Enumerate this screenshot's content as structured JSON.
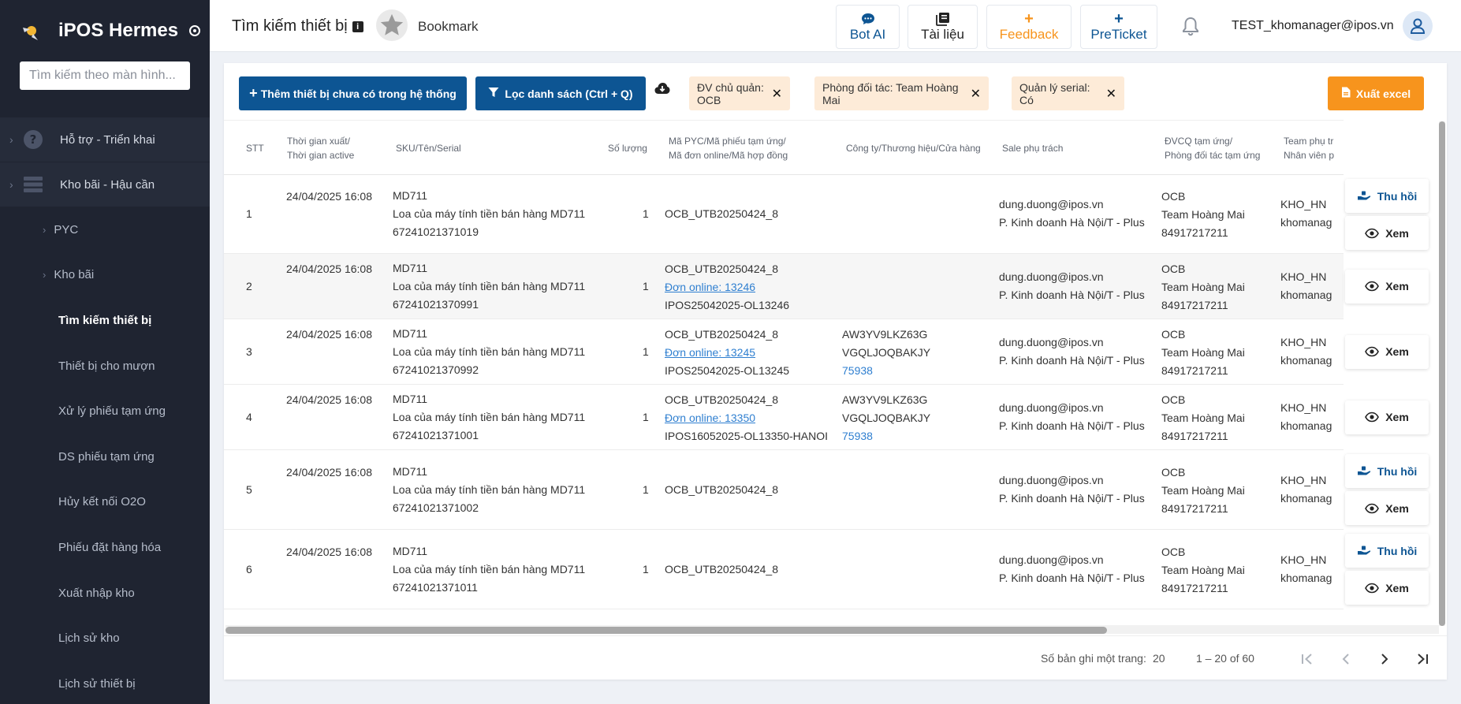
{
  "app": {
    "name": "iPOS Hermes"
  },
  "sidebar": {
    "search_placeholder": "Tìm kiếm theo màn hình...",
    "groups": [
      {
        "label": "Hỗ trợ - Triển khai",
        "icon": "help-circle-icon"
      },
      {
        "label": "Kho bãi - Hậu cần",
        "icon": "server-icon"
      }
    ],
    "subgroups": [
      {
        "label": "PYC"
      },
      {
        "label": "Kho bãi"
      }
    ],
    "items": [
      {
        "label": "Tìm kiếm thiết bị",
        "active": true
      },
      {
        "label": "Thiết bị cho mượn"
      },
      {
        "label": "Xử lý phiếu tạm ứng"
      },
      {
        "label": "DS phiếu tạm ứng"
      },
      {
        "label": "Hủy kết nối O2O"
      },
      {
        "label": "Phiếu đặt hàng hóa"
      },
      {
        "label": "Xuất nhập kho"
      },
      {
        "label": "Lịch sử kho"
      },
      {
        "label": "Lịch sử thiết bị"
      }
    ]
  },
  "header": {
    "title": "Tìm kiếm thiết bị",
    "info_glyph": "i",
    "bookmark": "Bookmark",
    "buttons": [
      {
        "label": "Bot AI",
        "icon": "chat-bubble-icon",
        "color": "#0d5593"
      },
      {
        "label": "Tài liệu",
        "icon": "book-icon",
        "color": "#222222"
      },
      {
        "label": "Feedback",
        "icon": "plus-icon",
        "color": "#f7941d"
      },
      {
        "label": "PreTicket",
        "icon": "plus-icon",
        "color": "#0d5593"
      }
    ],
    "user_email": "TEST_khomanager@ipos.vn"
  },
  "toolbar": {
    "add_device": "Thêm thiết bị chưa có trong hệ thống",
    "filter": "Lọc danh sách (Ctrl + Q)",
    "chips": [
      "ĐV chủ quản: OCB",
      "Phòng đối tác: Team Hoàng Mai",
      "Quản lý serial: Có"
    ],
    "export": "Xuất excel"
  },
  "table": {
    "headers": {
      "stt": "STT",
      "time1": "Thời gian xuất/",
      "time2": "Thời gian active",
      "sku": "SKU/Tên/Serial",
      "qty": "Số lượng",
      "code1": "Mã PYC/Mã phiếu tạm ứng/",
      "code2": "Mã đơn online/Mã hợp đồng",
      "company": "Công ty/Thương hiệu/Cửa hàng",
      "sale": "Sale phụ trách",
      "dv1": "ĐVCQ tạm ứng/",
      "dv2": "Phòng đối tác tạm ứng",
      "team1": "Team phụ tr",
      "team2": "Nhân viên p"
    },
    "rows": [
      {
        "stt": "1",
        "time": "24/04/2025 16:08",
        "sku": "MD711",
        "name": "Loa của máy tính tiền bán hàng MD711",
        "serial": "67241021371019",
        "qty": "1",
        "code": "OCB_UTB20250424_8",
        "online": "",
        "contract": "",
        "c1": "",
        "c2": "",
        "c3": "",
        "sale1": "dung.duong@ipos.vn",
        "sale2": "P. Kinh doanh Hà Nội/T - Plus",
        "dv1": "OCB",
        "dv2": "Team Hoàng Mai",
        "dv3": "84917217211",
        "team1": "KHO_HN",
        "team2": "khomanag",
        "recall": "Thu hồi",
        "view": "Xem"
      },
      {
        "stt": "2",
        "time": "24/04/2025 16:08",
        "sku": "MD711",
        "name": "Loa của máy tính tiền bán hàng MD711",
        "serial": "67241021370991",
        "qty": "1",
        "code": "OCB_UTB20250424_8",
        "online": "Đơn online: 13246",
        "contract": "IPOS25042025-OL13246",
        "c1": "",
        "c2": "",
        "c3": "",
        "sale1": "dung.duong@ipos.vn",
        "sale2": "P. Kinh doanh Hà Nội/T - Plus",
        "dv1": "OCB",
        "dv2": "Team Hoàng Mai",
        "dv3": "84917217211",
        "team1": "KHO_HN",
        "team2": "khomanag",
        "recall": "",
        "view": "Xem"
      },
      {
        "stt": "3",
        "time": "24/04/2025 16:08",
        "sku": "MD711",
        "name": "Loa của máy tính tiền bán hàng MD711",
        "serial": "67241021370992",
        "qty": "1",
        "code": "OCB_UTB20250424_8",
        "online": "Đơn online: 13245",
        "contract": "IPOS25042025-OL13245",
        "c1": "AW3YV9LKZ63G",
        "c2": "VGQLJOQBAKJY",
        "c3": "75938",
        "sale1": "dung.duong@ipos.vn",
        "sale2": "P. Kinh doanh Hà Nội/T - Plus",
        "dv1": "OCB",
        "dv2": "Team Hoàng Mai",
        "dv3": "84917217211",
        "team1": "KHO_HN",
        "team2": "khomanag",
        "recall": "",
        "view": "Xem"
      },
      {
        "stt": "4",
        "time": "24/04/2025 16:08",
        "sku": "MD711",
        "name": "Loa của máy tính tiền bán hàng MD711",
        "serial": "67241021371001",
        "qty": "1",
        "code": "OCB_UTB20250424_8",
        "online": "Đơn online: 13350",
        "contract": "IPOS16052025-OL13350-HANOI",
        "c1": "AW3YV9LKZ63G",
        "c2": "VGQLJOQBAKJY",
        "c3": "75938",
        "sale1": "dung.duong@ipos.vn",
        "sale2": "P. Kinh doanh Hà Nội/T - Plus",
        "dv1": "OCB",
        "dv2": "Team Hoàng Mai",
        "dv3": "84917217211",
        "team1": "KHO_HN",
        "team2": "khomanag",
        "recall": "",
        "view": "Xem"
      },
      {
        "stt": "5",
        "time": "24/04/2025 16:08",
        "sku": "MD711",
        "name": "Loa của máy tính tiền bán hàng MD711",
        "serial": "67241021371002",
        "qty": "1",
        "code": "OCB_UTB20250424_8",
        "online": "",
        "contract": "",
        "c1": "",
        "c2": "",
        "c3": "",
        "sale1": "dung.duong@ipos.vn",
        "sale2": "P. Kinh doanh Hà Nội/T - Plus",
        "dv1": "OCB",
        "dv2": "Team Hoàng Mai",
        "dv3": "84917217211",
        "team1": "KHO_HN",
        "team2": "khomanag",
        "recall": "Thu hồi",
        "view": "Xem"
      },
      {
        "stt": "6",
        "time": "24/04/2025 16:08",
        "sku": "MD711",
        "name": "Loa của máy tính tiền bán hàng MD711",
        "serial": "67241021371011",
        "qty": "1",
        "code": "OCB_UTB20250424_8",
        "online": "",
        "contract": "",
        "c1": "",
        "c2": "",
        "c3": "",
        "sale1": "dung.duong@ipos.vn",
        "sale2": "P. Kinh doanh Hà Nội/T - Plus",
        "dv1": "OCB",
        "dv2": "Team Hoàng Mai",
        "dv3": "84917217211",
        "team1": "KHO_HN",
        "team2": "khomanag",
        "recall": "Thu hồi",
        "view": "Xem"
      }
    ]
  },
  "pagination": {
    "per_page_label": "Số bản ghi một trang:",
    "per_page": "20",
    "range": "1 – 20 of 60"
  },
  "colors": {
    "primary": "#0d5593",
    "accent": "#f7941d",
    "chip_bg": "#fdebd8",
    "sidebar_bg": "#1f2431"
  }
}
